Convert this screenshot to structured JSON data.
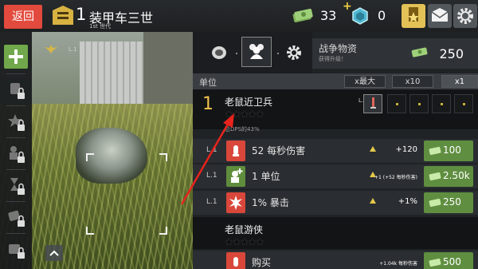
{
  "topbar": {
    "back_label": "返回",
    "unit_level": "1",
    "unit_name": "装甲车三世",
    "unit_generation": "1st 世代",
    "cash": "33",
    "plus": "+",
    "gems": "0"
  },
  "sidebar": {
    "slot_level": "L.1"
  },
  "panel": {
    "resource_title": "战争物资",
    "resource_subtitle": "获得升级！",
    "resource_value": "250",
    "list_title": "单位",
    "multipliers": [
      "x最大",
      "x10",
      "x1"
    ],
    "active_multiplier": "x1"
  },
  "units": [
    {
      "index": "1",
      "name": "老鼠近卫兵",
      "stars": "★★★★★",
      "slot_level": "L.1",
      "dps_share": "总DPS的43%",
      "upgrades": [
        {
          "level": "L.1",
          "label": "52 每秒伤害",
          "gain": "+120",
          "price": "100",
          "icon": "ammo-icon"
        },
        {
          "level": "L.1",
          "label": "1 单位",
          "gain": "+1 (+52 每秒伤害)",
          "price": "2.50k",
          "icon": "add-unit-icon"
        },
        {
          "level": "L.1",
          "label": "1% 暴击",
          "gain": "+1%",
          "price": "250",
          "icon": "critical-icon"
        }
      ]
    },
    {
      "name": "老鼠游侠",
      "stars": "★★★★★",
      "upgrades": [
        {
          "label": "购买",
          "gain": "+1.04k 每秒伤害",
          "price": "500",
          "icon": "ammo-icon"
        }
      ]
    }
  ],
  "colors": {
    "back_button": "#e24a3d",
    "price_button": "#5f8e40",
    "accent_gold": "#f0c24d",
    "pointer_red": "#e8231c"
  }
}
